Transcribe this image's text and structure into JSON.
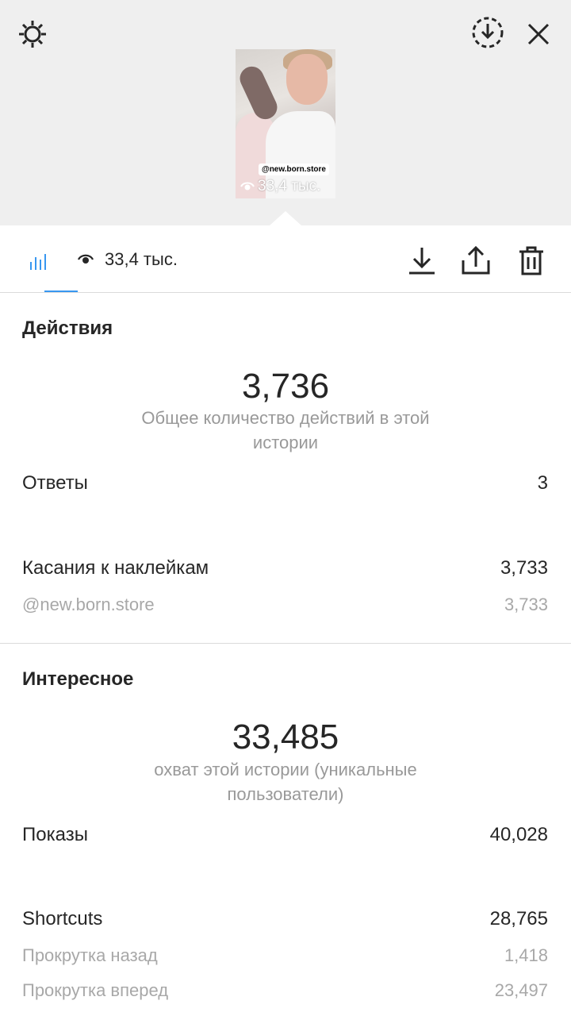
{
  "story": {
    "sticker": "@new.born.store",
    "views": "33,4 тыс."
  },
  "tabbar": {
    "views": "33,4 тыс."
  },
  "actions_section": {
    "title": "Действия",
    "total": "3,736",
    "total_caption": "Общее количество действий в этой истории",
    "rows": [
      {
        "label": "Ответы",
        "value": "3"
      },
      {
        "label": "Касания к наклейкам",
        "value": "3,733"
      },
      {
        "label": "@new.born.store",
        "value": "3,733"
      }
    ]
  },
  "interesting_section": {
    "title": "Интересное",
    "reach": "33,485",
    "reach_caption": "охват этой истории (уникальные пользователи)",
    "rows": [
      {
        "label": "Показы",
        "value": "40,028"
      },
      {
        "label": "Shortcuts",
        "value": "28,765"
      },
      {
        "label": "Прокрутка назад",
        "value": "1,418"
      },
      {
        "label": "Прокрутка вперед",
        "value": "23,497"
      }
    ]
  },
  "colors": {
    "accent": "#3897f0",
    "topbar": "#efefef"
  }
}
